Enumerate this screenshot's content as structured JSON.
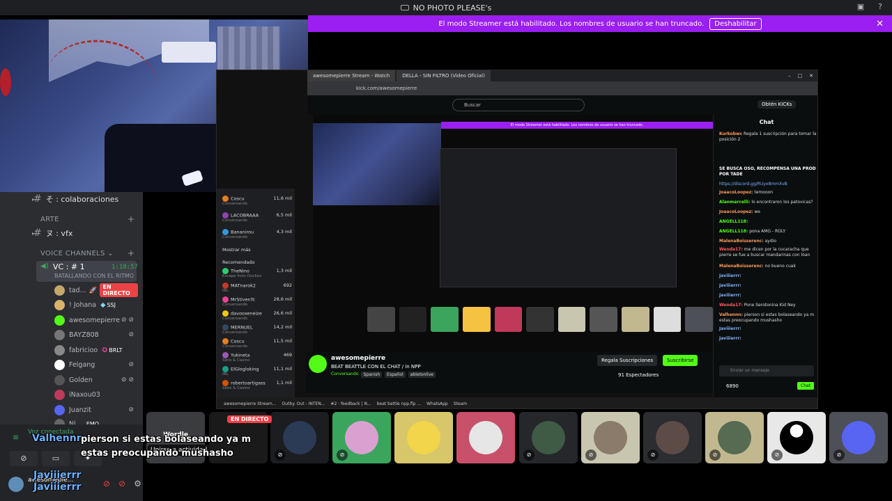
{
  "window": {
    "title": "NO PHOTO PLEASE's"
  },
  "banner": {
    "text": "El modo Streamer está habilitado. Los nombres de usuario se han truncado.",
    "button": "Deshabilitar"
  },
  "sidebar": {
    "channels": [
      {
        "name": "そ : colaboraciones"
      },
      {
        "name": "ヌ : vfx"
      }
    ],
    "categories": {
      "arte": "ARTE",
      "voice": "VOICE CHANNELS"
    },
    "voice_channel": {
      "name": "VC : # 1",
      "time": "1:18:57",
      "status": "BATALLANDO CON EL RITMO"
    },
    "members": [
      {
        "name": "tad...",
        "live": "EN DIRECTO"
      },
      {
        "name": "! Johana",
        "badge": "SSJ"
      },
      {
        "name": "awesomepierre"
      },
      {
        "name": "BAYZ808"
      },
      {
        "name": "fabricioo",
        "badge": "BRLT"
      },
      {
        "name": "Felgang"
      },
      {
        "name": "Golden"
      },
      {
        "name": "iNaxou03"
      },
      {
        "name": "Juanzit"
      },
      {
        "name": "Ni...",
        "badge": "EMO"
      }
    ]
  },
  "voice_panel": {
    "status": "Voz conectada",
    "me": "awesomepie..."
  },
  "overlay": {
    "user": "Valhennn",
    "message": "pierson si estas bolaseando ya m estas preocupando mushasho",
    "me1": "Javiiierrr",
    "me2": "Javiiierrr",
    "join": "Unirse a actividad",
    "wordle": "Wordle",
    "live": "EN DIRECTO"
  },
  "stream": {
    "tabs": [
      "awesomepierre Stream - Watch",
      "DELLA - SIN FILTRO (Video Oficial)"
    ],
    "url": "kick.com/awesomepierre",
    "search": "Buscar",
    "coins": "Obtén KICKs",
    "inner_banner": "El modo Streamer está habilitado. Los nombres de usuario se han truncado.",
    "channel": {
      "name": "awesomepierre",
      "title": "BEAT BEATTLE CON EL CHAT / in NPP",
      "category": "Conversando",
      "tags": [
        "Spanish",
        "Español",
        "abletonlive"
      ],
      "gift": "Regala Suscripciones",
      "subscribe": "Suscribirse",
      "viewers": "91 Espectadores"
    },
    "taskbar": [
      "awesomepierre Stream...",
      "Outby. Out - INTEN...",
      "#2 · feedback | N...",
      "beat battle npp.flp ...",
      "WhatsApp",
      "Steam"
    ],
    "mini_side": [
      {
        "name": "Coscu",
        "sub": "Conversando",
        "v": "11,6 mil"
      },
      {
        "name": "LACOBRAAA",
        "sub": "Conversando",
        "v": "6,5 mil"
      },
      {
        "name": "Bananirou",
        "sub": "Conversando",
        "v": "4,3 mil"
      },
      {
        "name": "Mostrar más",
        "sub": "",
        "v": ""
      },
      {
        "name": "Recomendado",
        "sub": "",
        "v": ""
      },
      {
        "name": "TheNino",
        "sub": "Escape from Duckov",
        "v": "1,3 mil"
      },
      {
        "name": "MATnarok2",
        "sub": "IRL",
        "v": "692"
      },
      {
        "name": "MrStivenTc",
        "sub": "Conversando",
        "v": "28,6 mil"
      },
      {
        "name": "davooxeneize",
        "sub": "Conversando",
        "v": "26,6 mil"
      },
      {
        "name": "MERNUEL",
        "sub": "Conversando",
        "v": "14,2 mil"
      },
      {
        "name": "Coscu",
        "sub": "Conversando",
        "v": "11,5 mil"
      },
      {
        "name": "Yukineta",
        "sub": "Slots & Casino",
        "v": "469"
      },
      {
        "name": "ElGlogloking",
        "sub": "IRL",
        "v": "11,1 mil"
      },
      {
        "name": "robertoartigass",
        "sub": "Slots & Casino",
        "v": "1,1 mil"
      }
    ],
    "chat": {
      "title": "Chat",
      "lines": [
        {
          "u": "Kurkobwc",
          "m": "Regala 1 suscripción para tomar la posición 2"
        },
        {
          "u": "",
          "m": "SE BUSCA OSO, RECOMPENSA UNA PROD POR TADE"
        },
        {
          "u": "",
          "m": "https://discord.gg/RUyx8mmXvB"
        },
        {
          "u": "JoaacoLoopez:",
          "m": "temooon"
        },
        {
          "u": "Alanmarcelli:",
          "m": "lo encontraron los patovicas?"
        },
        {
          "u": "JoaacoLoopez:",
          "m": "we"
        },
        {
          "u": "ANGELL118:",
          "m": ""
        },
        {
          "u": "ANGELL118:",
          "m": "pona AMG - ROLY"
        },
        {
          "u": "MalenaBoisserenc:",
          "m": "aydio"
        },
        {
          "u": "Wenda17:",
          "m": "me dicen por la cucaracha que pierre se fue a buscar mandarinas con loan"
        },
        {
          "u": "MalenaBoisserenc:",
          "m": "no bueno cuak"
        },
        {
          "u": "Javiiierrr:",
          "m": ""
        },
        {
          "u": "Javiiierrr:",
          "m": ""
        },
        {
          "u": "Javiiierrr:",
          "m": ""
        },
        {
          "u": "Wenda17:",
          "m": "Pone Serotonina Kid Ney"
        },
        {
          "u": "Valhennn:",
          "m": "pierson si estas bolaseando ya m estas preocupando mushasho"
        },
        {
          "u": "Javiiierrr:",
          "m": ""
        },
        {
          "u": "Javiiierrr:",
          "m": ""
        }
      ],
      "input": "Enviar un mensaje",
      "count": "6890",
      "send": "Chat"
    }
  },
  "colors": {
    "banner": "#9b1ff0",
    "kick_green": "#53fc18",
    "live_red": "#ed4245",
    "voice_green": "#3ba55d"
  }
}
